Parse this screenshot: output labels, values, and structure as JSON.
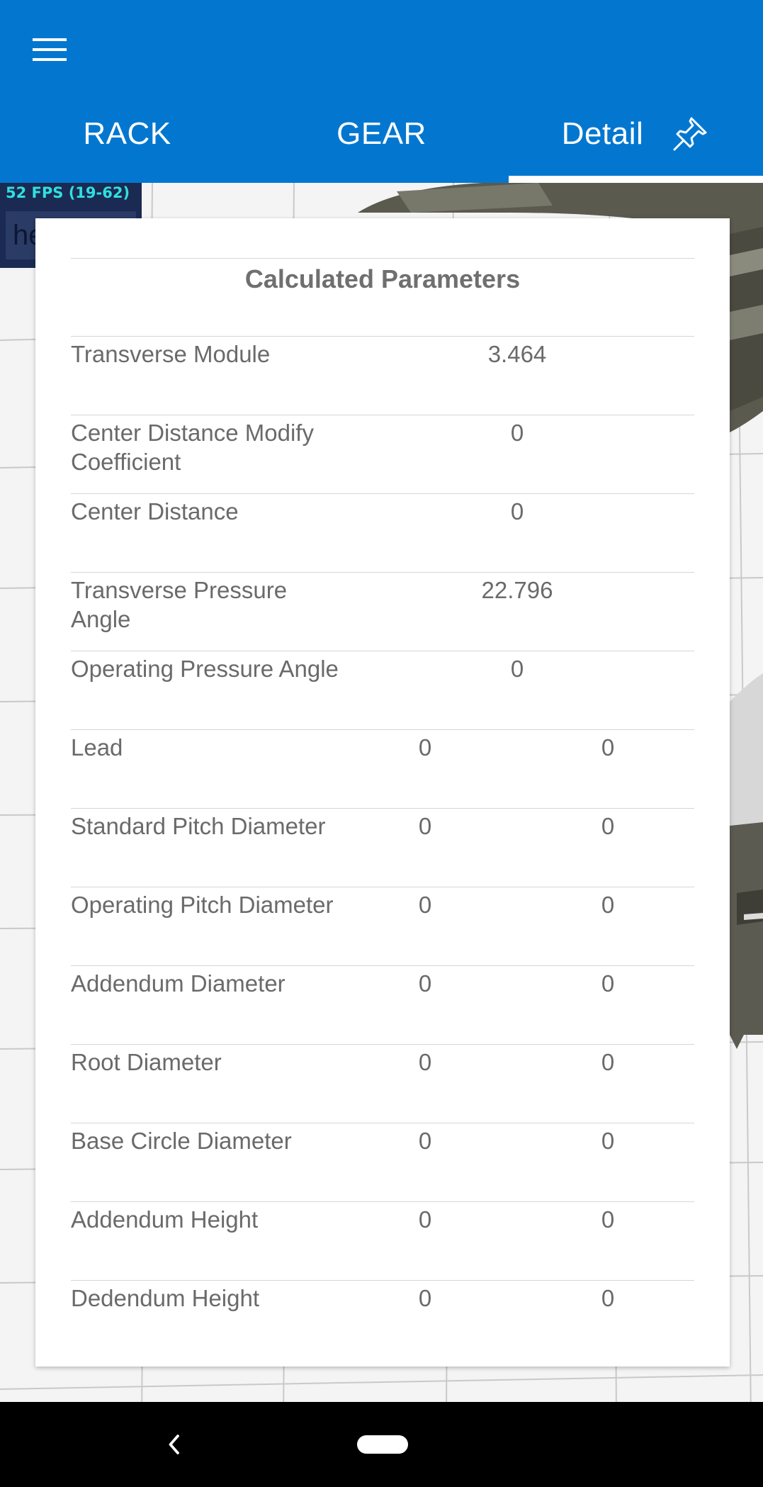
{
  "colors": {
    "app_bar": "#0377d0",
    "tab_text": "#ffffff",
    "fps_text": "#2fe0e0",
    "table_text": "#6a6a6a",
    "title_text": "#6f6f6f"
  },
  "header": {
    "menu_icon": "hamburger-menu-icon",
    "tabs": [
      {
        "label": "RACK",
        "active": false
      },
      {
        "label": "GEAR",
        "active": false
      },
      {
        "label": "Detail",
        "active": true,
        "icon": "pin-icon"
      }
    ]
  },
  "overlay": {
    "fps": "52 FPS (19-62)",
    "input_text": "hel"
  },
  "panel": {
    "title": "Calculated Parameters",
    "rows": [
      {
        "label": "Transverse Module",
        "values": [
          "3.464"
        ]
      },
      {
        "label": "Center Distance Modify Coefficient",
        "values": [
          "0"
        ]
      },
      {
        "label": "Center Distance",
        "values": [
          "0"
        ]
      },
      {
        "label": "Transverse Pressure Angle",
        "values": [
          "22.796"
        ]
      },
      {
        "label": "Operating Pressure Angle",
        "values": [
          "0"
        ]
      },
      {
        "label": "Lead",
        "values": [
          "0",
          "0"
        ]
      },
      {
        "label": "Standard Pitch Diameter",
        "values": [
          "0",
          "0"
        ]
      },
      {
        "label": "Operating Pitch Diameter",
        "values": [
          "0",
          "0"
        ]
      },
      {
        "label": "Addendum Diameter",
        "values": [
          "0",
          "0"
        ]
      },
      {
        "label": "Root Diameter",
        "values": [
          "0",
          "0"
        ]
      },
      {
        "label": "Base Circle Diameter",
        "values": [
          "0",
          "0"
        ]
      },
      {
        "label": "Addendum Height",
        "values": [
          "0",
          "0"
        ]
      },
      {
        "label": "Dedendum Height",
        "values": [
          "0",
          "0"
        ]
      }
    ]
  },
  "navbar": {
    "back_icon": "back-chevron-icon",
    "home_icon": "home-pill-icon"
  }
}
